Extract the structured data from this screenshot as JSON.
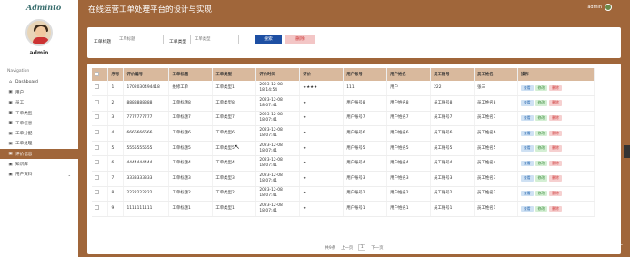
{
  "app": {
    "logo": "Adminto",
    "title": "在线运营工单处理平台的设计与实现",
    "user": "admin"
  },
  "sidebar": {
    "username": "admin",
    "nav_label": "Navigation",
    "items": [
      {
        "label": "Dashboard",
        "icon": "⌂"
      },
      {
        "label": "用户",
        "icon": "▣"
      },
      {
        "label": "员工",
        "icon": "▣"
      },
      {
        "label": "工单类型",
        "icon": "▣"
      },
      {
        "label": "工单信息",
        "icon": "▣"
      },
      {
        "label": "工单分配",
        "icon": "▣"
      },
      {
        "label": "工单处理",
        "icon": "▣"
      },
      {
        "label": "评价信息",
        "icon": "▣"
      },
      {
        "label": "知识库",
        "icon": "▣"
      },
      {
        "label": "用户资料",
        "icon": "▣"
      }
    ]
  },
  "search": {
    "field1_label": "工单标题",
    "field1_placeholder": "工单标题",
    "field2_label": "工单类型",
    "field2_placeholder": "工单类型",
    "search_button": "搜索",
    "delete_button": "删除"
  },
  "table": {
    "columns": [
      "",
      "序号",
      "评价编号",
      "工单标题",
      "工单类型",
      "评价时间",
      "评价",
      "用户账号",
      "用户姓名",
      "员工账号",
      "员工姓名",
      "操作"
    ],
    "rows": [
      [
        "1",
        "1702030494418",
        "维修工单",
        "工单类型1",
        "2023-12-08 18:14:54",
        "★★★★",
        "111",
        "用户",
        "222",
        "张三"
      ],
      [
        "2",
        "8888888888",
        "工单标题8",
        "工单类型8",
        "2023-12-08 18:07:41",
        "★",
        "用户账号8",
        "用户姓名8",
        "员工账号8",
        "员工姓名8"
      ],
      [
        "3",
        "7777777777",
        "工单标题7",
        "工单类型7",
        "2023-12-08 18:07:41",
        "★",
        "用户账号7",
        "用户姓名7",
        "员工账号7",
        "员工姓名7"
      ],
      [
        "4",
        "6666666666",
        "工单标题6",
        "工单类型6",
        "2023-12-08 18:07:41",
        "★",
        "用户账号6",
        "用户姓名6",
        "员工账号6",
        "员工姓名6"
      ],
      [
        "5",
        "5555555555",
        "工单标题5",
        "工单类型5",
        "2023-12-08 18:07:41",
        "★",
        "用户账号5",
        "用户姓名5",
        "员工账号5",
        "员工姓名5"
      ],
      [
        "6",
        "4444444444",
        "工单标题4",
        "工单类型4",
        "2023-12-08 18:07:41",
        "★",
        "用户账号4",
        "用户姓名4",
        "员工账号4",
        "员工姓名4"
      ],
      [
        "7",
        "3333333333",
        "工单标题3",
        "工单类型3",
        "2023-12-08 18:07:41",
        "★",
        "用户账号3",
        "用户姓名3",
        "员工账号3",
        "员工姓名3"
      ],
      [
        "8",
        "2222222222",
        "工单标题2",
        "工单类型2",
        "2023-12-08 18:07:41",
        "★",
        "用户账号2",
        "用户姓名2",
        "员工账号2",
        "员工姓名2"
      ],
      [
        "9",
        "1111111111",
        "工单标题1",
        "工单类型1",
        "2023-12-08 18:07:41",
        "★",
        "用户账号1",
        "用户姓名1",
        "员工账号1",
        "员工姓名1"
      ]
    ],
    "actions": {
      "view": "查看",
      "edit": "修改",
      "delete": "删除"
    }
  },
  "pager": {
    "total": "共9条",
    "prev": "上一页",
    "current": "1",
    "next": "下一页"
  },
  "watermark": "CSDN @路可程序设计"
}
